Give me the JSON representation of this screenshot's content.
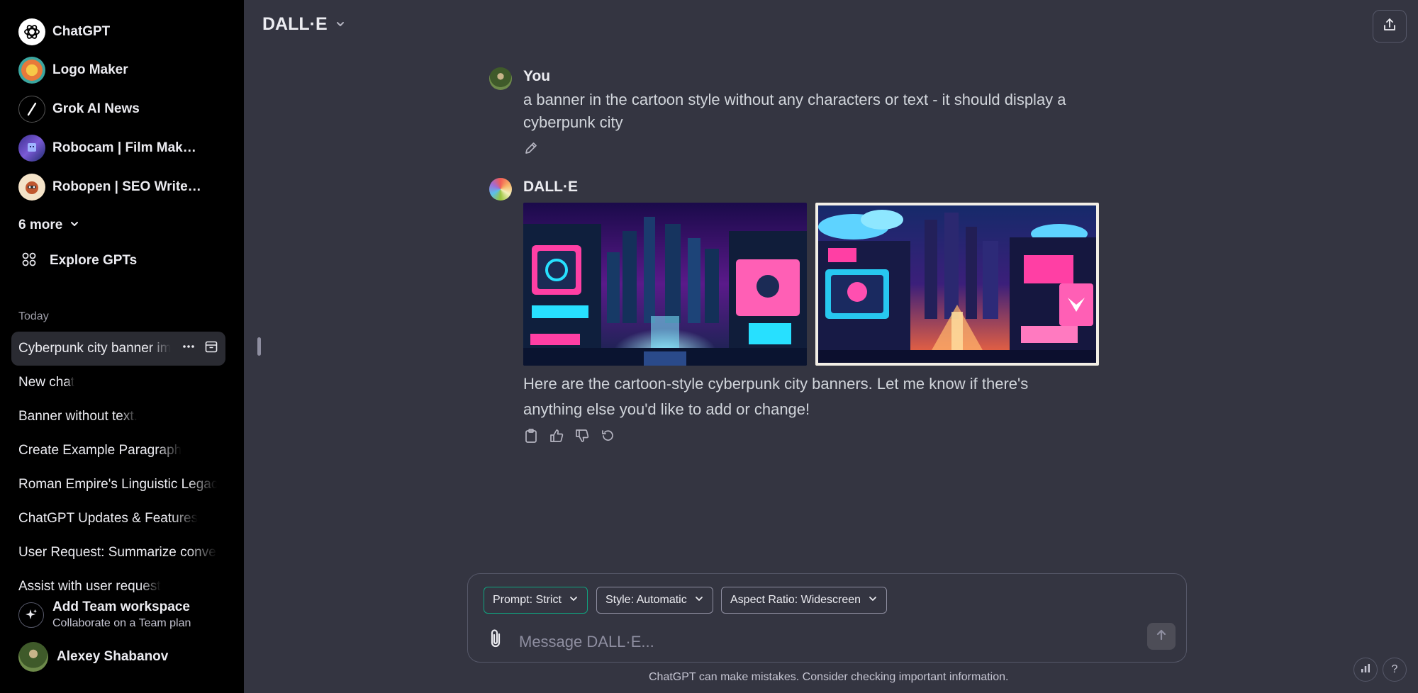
{
  "sidebar": {
    "gpts": [
      {
        "label": "ChatGPT",
        "icon": "openai-logo-icon"
      },
      {
        "label": "Logo Maker",
        "icon": "logo-maker-avatar"
      },
      {
        "label": "Grok AI News",
        "icon": "grok-slash-icon"
      },
      {
        "label": "Robocam | Film Maker...",
        "icon": "robocam-avatar"
      },
      {
        "label": "Robopen | SEO Writer ...",
        "icon": "robopen-avatar"
      }
    ],
    "more_label": "6 more",
    "explore_label": "Explore GPTs",
    "section_today": "Today",
    "history": [
      {
        "label": "Cyberpunk city banner im",
        "active": true
      },
      {
        "label": "New chat"
      },
      {
        "label": "Banner without text."
      },
      {
        "label": "Create Example Paragraph"
      },
      {
        "label": "Roman Empire's Linguistic Legacy"
      },
      {
        "label": "ChatGPT Updates & Features"
      },
      {
        "label": "User Request: Summarize conversation"
      },
      {
        "label": "Assist with user request"
      }
    ],
    "team": {
      "title": "Add Team workspace",
      "subtitle": "Collaborate on a Team plan"
    },
    "user_name": "Alexey Shabanov"
  },
  "header": {
    "model_name": "DALL·E"
  },
  "conversation": {
    "user_author": "You",
    "user_prompt": "a banner in the cartoon style without any characters or text - it should display a cyberpunk city",
    "assistant_author": "DALL·E",
    "assistant_reply": "Here are the cartoon-style cyberpunk city banners. Let me know if there's anything else you'd like to add or change!"
  },
  "composer": {
    "chips": [
      {
        "label": "Prompt: Strict",
        "selected": true
      },
      {
        "label": "Style: Automatic"
      },
      {
        "label": "Aspect Ratio: Widescreen"
      }
    ],
    "placeholder": "Message DALL·E..."
  },
  "footer": {
    "disclaimer": "ChatGPT can make mistakes. Consider checking important information.",
    "help_label": "?"
  },
  "colors": {
    "sidebar_bg": "#000000",
    "main_bg": "#343541",
    "accent": "#10a37f",
    "neon_pink": "#ff3fa4",
    "neon_cyan": "#27e0ff"
  }
}
